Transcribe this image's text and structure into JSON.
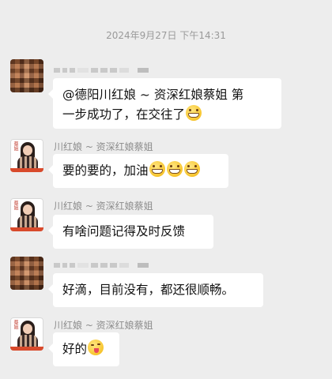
{
  "chat": {
    "timestamp": "2024年9月27日 下午14:31",
    "messages": [
      {
        "sender": "",
        "sender_redacted": true,
        "avatar": "blurred-avatar",
        "text": "@德阳川红娘 ~ 资深红娘蔡姐  第一步成功了，在交往了",
        "text_line1": "@德阳川红娘 ~ 资深红娘蔡姐  第",
        "text_line2": "一步成功了，在交往了",
        "emojis": [
          "grin"
        ]
      },
      {
        "sender": "川红娘 ~ 资深红娘蔡姐",
        "avatar": "matchmaker-avatar",
        "text": "要的要的，加油",
        "emojis": [
          "grin",
          "grin",
          "grin"
        ]
      },
      {
        "sender": "川红娘 ~ 资深红娘蔡姐",
        "avatar": "matchmaker-avatar",
        "text": "有啥问题记得及时反馈",
        "emojis": []
      },
      {
        "sender": "",
        "sender_redacted": true,
        "avatar": "blurred-avatar",
        "text": "好滴，目前没有，都还很顺畅。",
        "emojis": []
      },
      {
        "sender": "川红娘 ~ 资深红娘蔡姐",
        "avatar": "matchmaker-avatar",
        "text": "好的",
        "emojis": [
          "wink"
        ]
      }
    ]
  },
  "colors": {
    "background": "#ededed",
    "bubble": "#ffffff",
    "sender_text": "#8c8c8c",
    "timestamp_text": "#9a9a9a"
  }
}
